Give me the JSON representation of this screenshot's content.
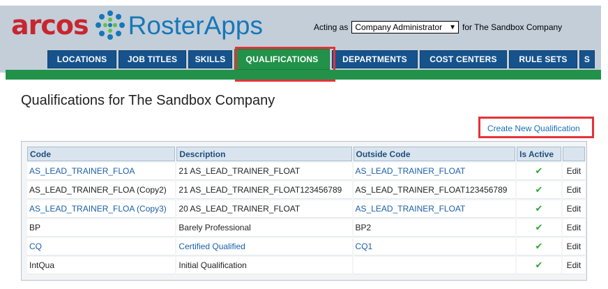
{
  "header": {
    "logo_brand": "arcos",
    "logo_product": "RosterApps",
    "acting_as_prefix": "Acting as",
    "role_selected": "Company Administrator",
    "acting_as_suffix": "for The Sandbox Company"
  },
  "tabs": [
    {
      "label": "LOCATIONS",
      "active": false
    },
    {
      "label": "JOB TITLES",
      "active": false
    },
    {
      "label": "SKILLS",
      "active": false
    },
    {
      "label": "QUALIFICATIONS",
      "active": true
    },
    {
      "label": "DEPARTMENTS",
      "active": false
    },
    {
      "label": "COST CENTERS",
      "active": false
    },
    {
      "label": "RULE SETS",
      "active": false
    },
    {
      "label": "S",
      "active": false
    }
  ],
  "page": {
    "title": "Qualifications for The Sandbox Company",
    "create_link": "Create New Qualification"
  },
  "table": {
    "headers": [
      "Code",
      "Description",
      "Outside Code",
      "Is Active",
      ""
    ],
    "rows": [
      {
        "code": "AS_LEAD_TRAINER_FLOA",
        "description": "21 AS_LEAD_TRAINER_FLOAT",
        "outside": "AS_LEAD_TRAINER_FLOAT",
        "active": "✔",
        "edit": "Edit",
        "linked": true
      },
      {
        "code": "AS_LEAD_TRAINER_FLOA (Copy2)",
        "description": "21 AS_LEAD_TRAINER_FLOAT123456789",
        "outside": "AS_LEAD_TRAINER_FLOAT123456789",
        "active": "✔",
        "edit": "Edit",
        "linked": false
      },
      {
        "code": "AS_LEAD_TRAINER_FLOA (Copy3)",
        "description": "20 AS_LEAD_TRAINER_FLOAT",
        "outside": "AS_LEAD_TRAINER_FLOAT",
        "active": "✔",
        "edit": "Edit",
        "linked": true
      },
      {
        "code": "BP",
        "description": "Barely Professional",
        "outside": "BP2",
        "active": "✔",
        "edit": "Edit",
        "linked": false
      },
      {
        "code": "CQ",
        "description": "Certified Qualified",
        "outside": "CQ1",
        "active": "✔",
        "edit": "Edit",
        "linked": true
      },
      {
        "code": "IntQua",
        "description": "Initial Qualification",
        "outside": "",
        "active": "✔",
        "edit": "Edit",
        "linked": false
      }
    ]
  },
  "colors": {
    "brand_red": "#c8262e",
    "brand_blue": "#1777b8",
    "tab_blue": "#16538d",
    "active_green": "#22924a",
    "highlight_red": "#e53238",
    "link_blue": "#1a5fa8",
    "check_green": "#2aa830"
  }
}
